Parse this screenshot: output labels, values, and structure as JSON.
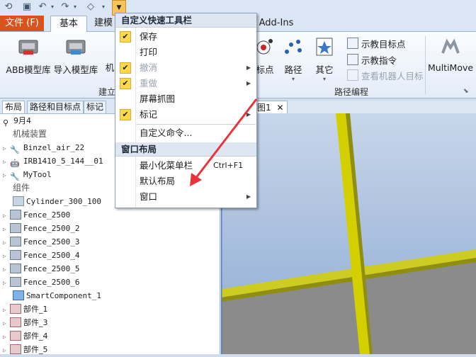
{
  "tabs": {
    "file": "文件 (F)",
    "basic": "基本",
    "modeling": "建模",
    "addins": "Add-Ins"
  },
  "ribbon": {
    "abb_library": "ABB模型库",
    "import_library": "导入模型库",
    "machine_partial": "机",
    "build_partial": "建立",
    "target_point": "标点",
    "path": "路径",
    "other": "其它",
    "teach_target": "示教目标点",
    "teach_instruction": "示教指令",
    "view_robot_target": "查看机器人目标",
    "multimove": "MultiMove",
    "path_programming": "路径编程"
  },
  "panel_tabs": [
    "布局",
    "路径和目标点",
    "标记"
  ],
  "tree": {
    "station": "9月4",
    "category_machines": "机械装置",
    "machines": [
      "Binzel_air_22",
      "IRB1410_5_144__01",
      "MyTool"
    ],
    "category_parts": "组件",
    "parts": [
      "Cylinder_300_100",
      "Fence_2500",
      "Fence_2500_2",
      "Fence_2500_3",
      "Fence_2500_4",
      "Fence_2500_5",
      "Fence_2500_6",
      "SmartComponent_1",
      "部件_1",
      "部件_3",
      "部件_4",
      "部件_5"
    ]
  },
  "doc_tab": "图1",
  "menu": {
    "header1": "自定义快速工具栏",
    "save": "保存",
    "print": "打印",
    "undo": "撤消",
    "redo": "重做",
    "screenshot": "屏幕抓图",
    "markup": "标记",
    "customize": "自定义命令...",
    "header2": "窗口布局",
    "minimize_ribbon": "最小化菜单栏",
    "minimize_shortcut": "Ctrl+F1",
    "default_layout": "默认布局",
    "window": "窗口"
  },
  "colors": {
    "file_tab": "#d9531e",
    "check_bg": "#fbd84c",
    "arrow": "#e8333a",
    "beam": "#d4d000",
    "floor": "#8b8b8b"
  }
}
